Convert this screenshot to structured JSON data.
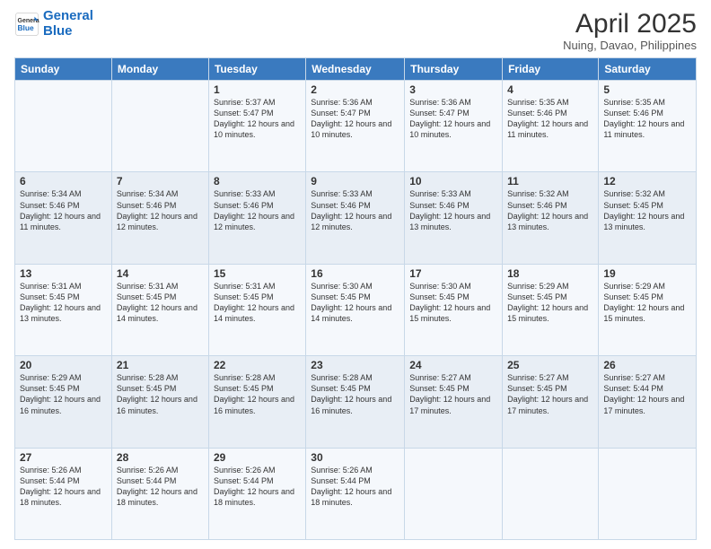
{
  "logo": {
    "line1": "General",
    "line2": "Blue"
  },
  "title": "April 2025",
  "subtitle": "Nuing, Davao, Philippines",
  "weekdays": [
    "Sunday",
    "Monday",
    "Tuesday",
    "Wednesday",
    "Thursday",
    "Friday",
    "Saturday"
  ],
  "weeks": [
    [
      {
        "day": "",
        "info": ""
      },
      {
        "day": "",
        "info": ""
      },
      {
        "day": "1",
        "info": "Sunrise: 5:37 AM\nSunset: 5:47 PM\nDaylight: 12 hours and 10 minutes."
      },
      {
        "day": "2",
        "info": "Sunrise: 5:36 AM\nSunset: 5:47 PM\nDaylight: 12 hours and 10 minutes."
      },
      {
        "day": "3",
        "info": "Sunrise: 5:36 AM\nSunset: 5:47 PM\nDaylight: 12 hours and 10 minutes."
      },
      {
        "day": "4",
        "info": "Sunrise: 5:35 AM\nSunset: 5:46 PM\nDaylight: 12 hours and 11 minutes."
      },
      {
        "day": "5",
        "info": "Sunrise: 5:35 AM\nSunset: 5:46 PM\nDaylight: 12 hours and 11 minutes."
      }
    ],
    [
      {
        "day": "6",
        "info": "Sunrise: 5:34 AM\nSunset: 5:46 PM\nDaylight: 12 hours and 11 minutes."
      },
      {
        "day": "7",
        "info": "Sunrise: 5:34 AM\nSunset: 5:46 PM\nDaylight: 12 hours and 12 minutes."
      },
      {
        "day": "8",
        "info": "Sunrise: 5:33 AM\nSunset: 5:46 PM\nDaylight: 12 hours and 12 minutes."
      },
      {
        "day": "9",
        "info": "Sunrise: 5:33 AM\nSunset: 5:46 PM\nDaylight: 12 hours and 12 minutes."
      },
      {
        "day": "10",
        "info": "Sunrise: 5:33 AM\nSunset: 5:46 PM\nDaylight: 12 hours and 13 minutes."
      },
      {
        "day": "11",
        "info": "Sunrise: 5:32 AM\nSunset: 5:46 PM\nDaylight: 12 hours and 13 minutes."
      },
      {
        "day": "12",
        "info": "Sunrise: 5:32 AM\nSunset: 5:45 PM\nDaylight: 12 hours and 13 minutes."
      }
    ],
    [
      {
        "day": "13",
        "info": "Sunrise: 5:31 AM\nSunset: 5:45 PM\nDaylight: 12 hours and 13 minutes."
      },
      {
        "day": "14",
        "info": "Sunrise: 5:31 AM\nSunset: 5:45 PM\nDaylight: 12 hours and 14 minutes."
      },
      {
        "day": "15",
        "info": "Sunrise: 5:31 AM\nSunset: 5:45 PM\nDaylight: 12 hours and 14 minutes."
      },
      {
        "day": "16",
        "info": "Sunrise: 5:30 AM\nSunset: 5:45 PM\nDaylight: 12 hours and 14 minutes."
      },
      {
        "day": "17",
        "info": "Sunrise: 5:30 AM\nSunset: 5:45 PM\nDaylight: 12 hours and 15 minutes."
      },
      {
        "day": "18",
        "info": "Sunrise: 5:29 AM\nSunset: 5:45 PM\nDaylight: 12 hours and 15 minutes."
      },
      {
        "day": "19",
        "info": "Sunrise: 5:29 AM\nSunset: 5:45 PM\nDaylight: 12 hours and 15 minutes."
      }
    ],
    [
      {
        "day": "20",
        "info": "Sunrise: 5:29 AM\nSunset: 5:45 PM\nDaylight: 12 hours and 16 minutes."
      },
      {
        "day": "21",
        "info": "Sunrise: 5:28 AM\nSunset: 5:45 PM\nDaylight: 12 hours and 16 minutes."
      },
      {
        "day": "22",
        "info": "Sunrise: 5:28 AM\nSunset: 5:45 PM\nDaylight: 12 hours and 16 minutes."
      },
      {
        "day": "23",
        "info": "Sunrise: 5:28 AM\nSunset: 5:45 PM\nDaylight: 12 hours and 16 minutes."
      },
      {
        "day": "24",
        "info": "Sunrise: 5:27 AM\nSunset: 5:45 PM\nDaylight: 12 hours and 17 minutes."
      },
      {
        "day": "25",
        "info": "Sunrise: 5:27 AM\nSunset: 5:45 PM\nDaylight: 12 hours and 17 minutes."
      },
      {
        "day": "26",
        "info": "Sunrise: 5:27 AM\nSunset: 5:44 PM\nDaylight: 12 hours and 17 minutes."
      }
    ],
    [
      {
        "day": "27",
        "info": "Sunrise: 5:26 AM\nSunset: 5:44 PM\nDaylight: 12 hours and 18 minutes."
      },
      {
        "day": "28",
        "info": "Sunrise: 5:26 AM\nSunset: 5:44 PM\nDaylight: 12 hours and 18 minutes."
      },
      {
        "day": "29",
        "info": "Sunrise: 5:26 AM\nSunset: 5:44 PM\nDaylight: 12 hours and 18 minutes."
      },
      {
        "day": "30",
        "info": "Sunrise: 5:26 AM\nSunset: 5:44 PM\nDaylight: 12 hours and 18 minutes."
      },
      {
        "day": "",
        "info": ""
      },
      {
        "day": "",
        "info": ""
      },
      {
        "day": "",
        "info": ""
      }
    ]
  ]
}
